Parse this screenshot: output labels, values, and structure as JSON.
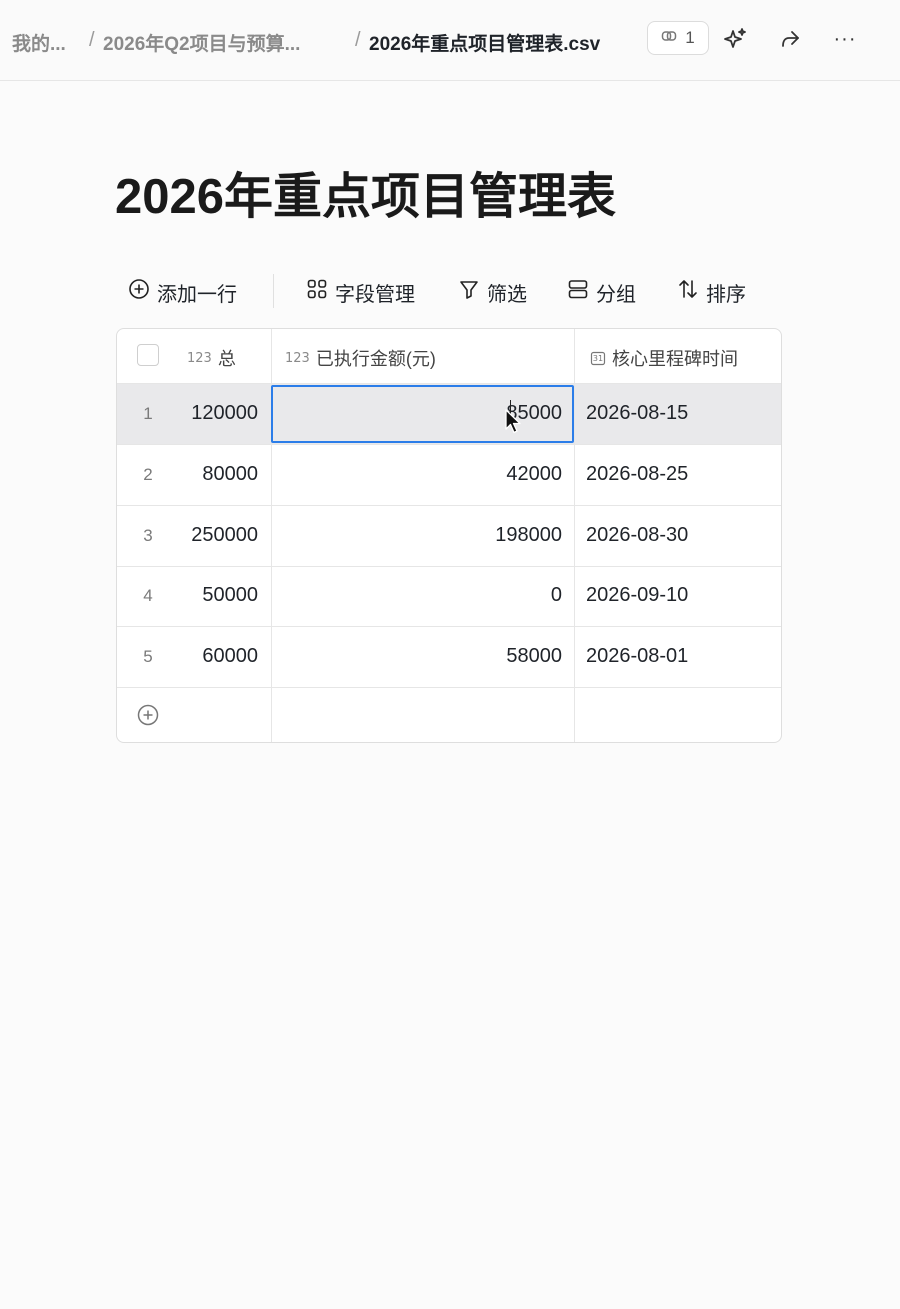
{
  "breadcrumb": {
    "items": [
      "我的...",
      "2026年Q2项目与预算...",
      "2026年重点项目管理表.csv"
    ],
    "separator": "/"
  },
  "header": {
    "collab_count": "1",
    "icons": [
      "link-icon",
      "ai-sparkle-icon",
      "share-forward-icon",
      "more-icon"
    ],
    "more_label": "···"
  },
  "page": {
    "title": "2026年重点项目管理表"
  },
  "toolbar": {
    "add_row": "添加一行",
    "field_manage": "字段管理",
    "filter": "筛选",
    "group": "分组",
    "sort": "排序"
  },
  "table": {
    "columns": [
      {
        "type_tag": "123",
        "label": "总"
      },
      {
        "type_tag": "123",
        "label": "已执行金额(元)"
      },
      {
        "type_tag": "31",
        "label": "核心里程碑时间"
      }
    ],
    "rows": [
      {
        "index": "1",
        "total": "120000",
        "executed": "85000",
        "milestone": "2026-08-15"
      },
      {
        "index": "2",
        "total": "80000",
        "executed": "42000",
        "milestone": "2026-08-25"
      },
      {
        "index": "3",
        "total": "250000",
        "executed": "198000",
        "milestone": "2026-08-30"
      },
      {
        "index": "4",
        "total": "50000",
        "executed": "0",
        "milestone": "2026-09-10"
      },
      {
        "index": "5",
        "total": "60000",
        "executed": "58000",
        "milestone": "2026-08-01"
      }
    ]
  },
  "colors": {
    "accent": "#2b7de9",
    "selected_row": "#e9e9eb",
    "border": "#e6e6e6"
  }
}
